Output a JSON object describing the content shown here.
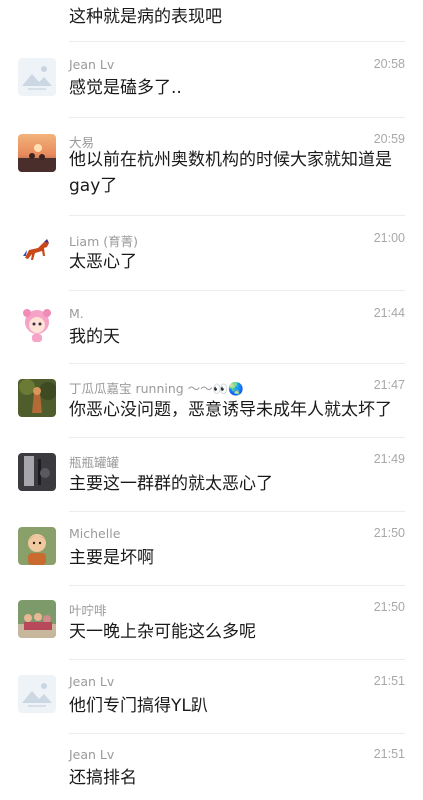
{
  "top_message": {
    "text": "这种就是病的表现吧"
  },
  "messages": [
    {
      "name": "Jean Lv",
      "time": "20:58",
      "text": "感觉是磕多了..",
      "avatar": "landscape-placeholder-icon"
    },
    {
      "name": "大易",
      "time": "20:59",
      "text": "他以前在杭州奥数机构的时候大家就知道是gay了",
      "avatar": "sunset-photo"
    },
    {
      "name": "Liam (育菁)",
      "time": "21:00",
      "text": "太恶心了",
      "avatar": "horse-icon"
    },
    {
      "name": "M.",
      "time": "21:44",
      "text": "我的天",
      "avatar": "pink-cartoon-girl"
    },
    {
      "name": "丁瓜瓜嘉宝 running ～～👀🌏",
      "time": "21:47",
      "text": "你恶心没问题，恶意诱导未成年人就太坏了",
      "avatar": "nature-photo"
    },
    {
      "name": "瓶瓶罐罐",
      "time": "21:49",
      "text": "主要这一群群的就太恶心了",
      "avatar": "dark-photo"
    },
    {
      "name": "Michelle",
      "time": "21:50",
      "text": "主要是坏啊",
      "avatar": "child-photo"
    },
    {
      "name": "叶咛啡",
      "time": "21:50",
      "text": "天一晚上杂可能这么多呢",
      "avatar": "group-photo"
    },
    {
      "name": "Jean Lv",
      "time": "21:51",
      "text": "他们专门搞得YL趴",
      "avatar": "landscape-placeholder-icon"
    },
    {
      "name": "Jean Lv",
      "time": "21:51",
      "text": "还搞排名",
      "avatar": ""
    }
  ]
}
